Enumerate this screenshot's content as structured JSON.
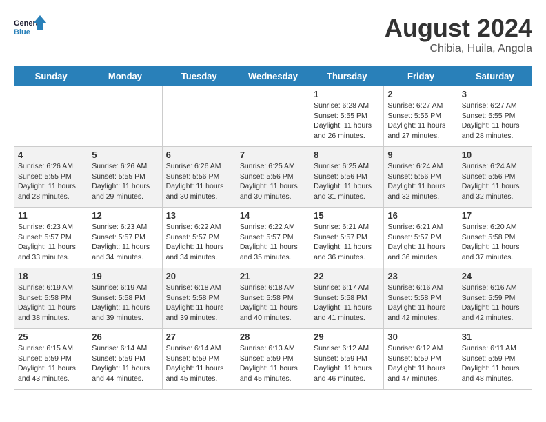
{
  "logo": {
    "text_general": "General",
    "text_blue": "Blue"
  },
  "header": {
    "title": "August 2024",
    "subtitle": "Chibia, Huila, Angola"
  },
  "days_of_week": [
    "Sunday",
    "Monday",
    "Tuesday",
    "Wednesday",
    "Thursday",
    "Friday",
    "Saturday"
  ],
  "weeks": [
    [
      {
        "day": "",
        "detail": ""
      },
      {
        "day": "",
        "detail": ""
      },
      {
        "day": "",
        "detail": ""
      },
      {
        "day": "",
        "detail": ""
      },
      {
        "day": "1",
        "detail": "Sunrise: 6:28 AM\nSunset: 5:55 PM\nDaylight: 11 hours and 26 minutes."
      },
      {
        "day": "2",
        "detail": "Sunrise: 6:27 AM\nSunset: 5:55 PM\nDaylight: 11 hours and 27 minutes."
      },
      {
        "day": "3",
        "detail": "Sunrise: 6:27 AM\nSunset: 5:55 PM\nDaylight: 11 hours and 28 minutes."
      }
    ],
    [
      {
        "day": "4",
        "detail": "Sunrise: 6:26 AM\nSunset: 5:55 PM\nDaylight: 11 hours and 28 minutes."
      },
      {
        "day": "5",
        "detail": "Sunrise: 6:26 AM\nSunset: 5:55 PM\nDaylight: 11 hours and 29 minutes."
      },
      {
        "day": "6",
        "detail": "Sunrise: 6:26 AM\nSunset: 5:56 PM\nDaylight: 11 hours and 30 minutes."
      },
      {
        "day": "7",
        "detail": "Sunrise: 6:25 AM\nSunset: 5:56 PM\nDaylight: 11 hours and 30 minutes."
      },
      {
        "day": "8",
        "detail": "Sunrise: 6:25 AM\nSunset: 5:56 PM\nDaylight: 11 hours and 31 minutes."
      },
      {
        "day": "9",
        "detail": "Sunrise: 6:24 AM\nSunset: 5:56 PM\nDaylight: 11 hours and 32 minutes."
      },
      {
        "day": "10",
        "detail": "Sunrise: 6:24 AM\nSunset: 5:56 PM\nDaylight: 11 hours and 32 minutes."
      }
    ],
    [
      {
        "day": "11",
        "detail": "Sunrise: 6:23 AM\nSunset: 5:57 PM\nDaylight: 11 hours and 33 minutes."
      },
      {
        "day": "12",
        "detail": "Sunrise: 6:23 AM\nSunset: 5:57 PM\nDaylight: 11 hours and 34 minutes."
      },
      {
        "day": "13",
        "detail": "Sunrise: 6:22 AM\nSunset: 5:57 PM\nDaylight: 11 hours and 34 minutes."
      },
      {
        "day": "14",
        "detail": "Sunrise: 6:22 AM\nSunset: 5:57 PM\nDaylight: 11 hours and 35 minutes."
      },
      {
        "day": "15",
        "detail": "Sunrise: 6:21 AM\nSunset: 5:57 PM\nDaylight: 11 hours and 36 minutes."
      },
      {
        "day": "16",
        "detail": "Sunrise: 6:21 AM\nSunset: 5:57 PM\nDaylight: 11 hours and 36 minutes."
      },
      {
        "day": "17",
        "detail": "Sunrise: 6:20 AM\nSunset: 5:58 PM\nDaylight: 11 hours and 37 minutes."
      }
    ],
    [
      {
        "day": "18",
        "detail": "Sunrise: 6:19 AM\nSunset: 5:58 PM\nDaylight: 11 hours and 38 minutes."
      },
      {
        "day": "19",
        "detail": "Sunrise: 6:19 AM\nSunset: 5:58 PM\nDaylight: 11 hours and 39 minutes."
      },
      {
        "day": "20",
        "detail": "Sunrise: 6:18 AM\nSunset: 5:58 PM\nDaylight: 11 hours and 39 minutes."
      },
      {
        "day": "21",
        "detail": "Sunrise: 6:18 AM\nSunset: 5:58 PM\nDaylight: 11 hours and 40 minutes."
      },
      {
        "day": "22",
        "detail": "Sunrise: 6:17 AM\nSunset: 5:58 PM\nDaylight: 11 hours and 41 minutes."
      },
      {
        "day": "23",
        "detail": "Sunrise: 6:16 AM\nSunset: 5:58 PM\nDaylight: 11 hours and 42 minutes."
      },
      {
        "day": "24",
        "detail": "Sunrise: 6:16 AM\nSunset: 5:59 PM\nDaylight: 11 hours and 42 minutes."
      }
    ],
    [
      {
        "day": "25",
        "detail": "Sunrise: 6:15 AM\nSunset: 5:59 PM\nDaylight: 11 hours and 43 minutes."
      },
      {
        "day": "26",
        "detail": "Sunrise: 6:14 AM\nSunset: 5:59 PM\nDaylight: 11 hours and 44 minutes."
      },
      {
        "day": "27",
        "detail": "Sunrise: 6:14 AM\nSunset: 5:59 PM\nDaylight: 11 hours and 45 minutes."
      },
      {
        "day": "28",
        "detail": "Sunrise: 6:13 AM\nSunset: 5:59 PM\nDaylight: 11 hours and 45 minutes."
      },
      {
        "day": "29",
        "detail": "Sunrise: 6:12 AM\nSunset: 5:59 PM\nDaylight: 11 hours and 46 minutes."
      },
      {
        "day": "30",
        "detail": "Sunrise: 6:12 AM\nSunset: 5:59 PM\nDaylight: 11 hours and 47 minutes."
      },
      {
        "day": "31",
        "detail": "Sunrise: 6:11 AM\nSunset: 5:59 PM\nDaylight: 11 hours and 48 minutes."
      }
    ]
  ]
}
